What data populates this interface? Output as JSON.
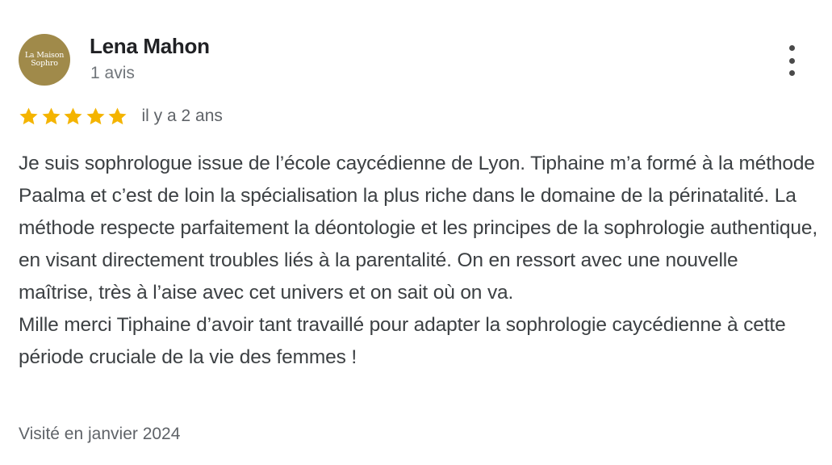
{
  "review": {
    "author": {
      "name": "Lena Mahon",
      "review_count": "1 avis",
      "avatar": {
        "line1": "La Maison",
        "line2": "Sophro",
        "color": "#a08a4a"
      }
    },
    "rating": {
      "stars": 5,
      "max": 5,
      "star_color": "#f4b400",
      "date": "il y a 2 ans"
    },
    "text": {
      "paragraph1": "Je suis sophrologue issue de l’école caycédienne de Lyon. Tiphaine m’a formé à la méthode Paalma et c’est de loin la spécialisation la plus riche dans le domaine de la périnatalité. La méthode respecte parfaitement la déontologie et les principes de la sophrologie authentique, en visant directement troubles liés à la parentalité. On en ressort avec une nouvelle maîtrise, très à l’aise avec cet univers et on sait où on va.",
      "paragraph2": "Mille merci Tiphaine d’avoir tant travaillé pour adapter la sophrologie caycédienne à cette période cruciale de la vie des femmes !"
    },
    "visit": "Visité en janvier 2024",
    "menu_icon": "more-vert-icon"
  }
}
